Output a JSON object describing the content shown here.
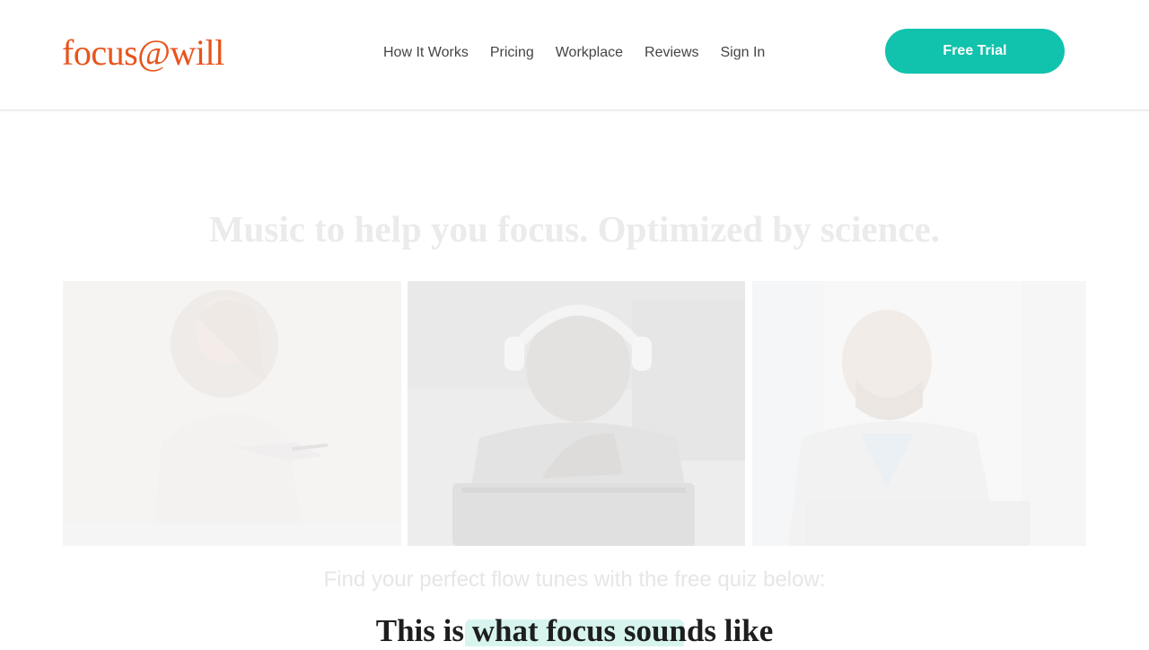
{
  "brand": {
    "logo_text": "focus@will",
    "logo_color": "#e8541c",
    "accent_color": "#11c2ac"
  },
  "nav": {
    "items": [
      {
        "label": "How It Works"
      },
      {
        "label": "Pricing"
      },
      {
        "label": "Workplace"
      },
      {
        "label": "Reviews"
      },
      {
        "label": "Sign In"
      }
    ]
  },
  "cta": {
    "label": "Free Trial"
  },
  "hero": {
    "title": "Music to help you focus. Optimized by science."
  },
  "photos": {
    "items": [
      {
        "subject": "woman-at-desk"
      },
      {
        "subject": "man-with-headphones-at-laptop"
      },
      {
        "subject": "man-in-jacket-at-laptop"
      }
    ]
  },
  "quiz": {
    "prompt": "Find your perfect flow tunes with the free quiz below:"
  },
  "section": {
    "title": "This is what focus sounds like"
  }
}
